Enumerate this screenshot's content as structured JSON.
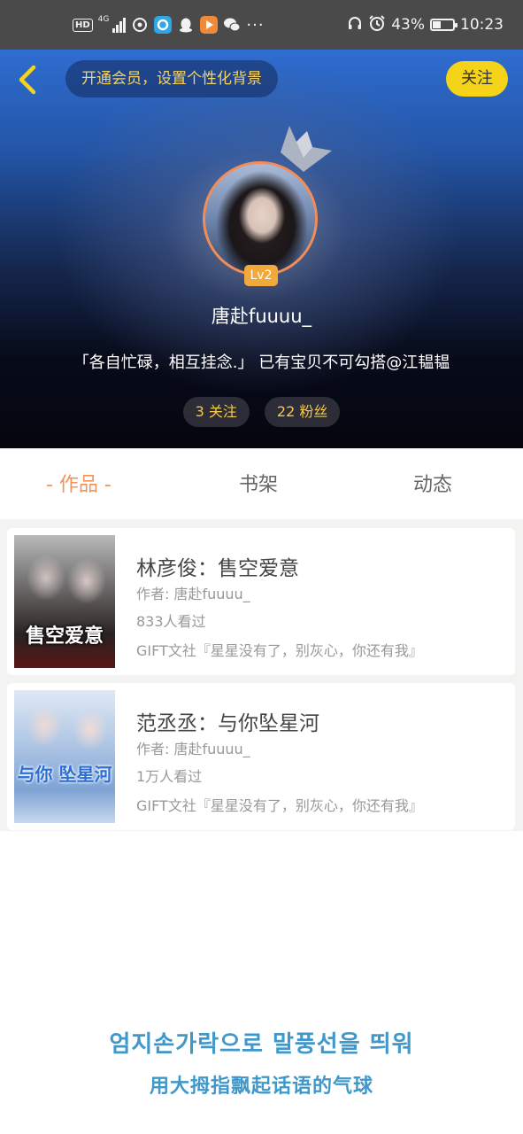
{
  "status_bar": {
    "hd": "HD",
    "network": "4G",
    "battery": "43%",
    "battery_level": 0.43,
    "time": "10:23",
    "icons": [
      "hd-icon",
      "signal-icon",
      "sync-icon",
      "browser-app-icon",
      "qq-icon",
      "video-app-icon",
      "wechat-icon",
      "more-dots-icon",
      "headphones-icon",
      "alarm-icon",
      "battery-icon"
    ]
  },
  "header": {
    "vip_banner": "开通会员，设置个性化背景",
    "follow_label": "关注",
    "level": "Lv2",
    "username": "唐赴fuuuu_",
    "bio": "「各自忙碌，相互挂念.」 已有宝贝不可勾搭@江韫韫",
    "stats": {
      "following": "3 关注",
      "fans": "22 粉丝"
    },
    "colors": {
      "accent_yellow": "#f5d319",
      "avatar_ring": "#f28c58",
      "level_badge": "#f2a93b"
    }
  },
  "tabs": {
    "works": "- 作品 -",
    "bookshelf": "书架",
    "moments": "动态",
    "active_color": "#f0935c"
  },
  "works": [
    {
      "title": "林彦俊：售空爱意",
      "author": "作者: 唐赴fuuuu_",
      "views": "833人看过",
      "desc": "GIFT文社『星星没有了，别灰心，你还有我』",
      "cover_text": "售空爱意"
    },
    {
      "title": "范丞丞：与你坠星河",
      "author": "作者: 唐赴fuuuu_",
      "views": "1万人看过",
      "desc": "GIFT文社『星星没有了，别灰心，你还有我』",
      "cover_text": "与你 坠星河"
    }
  ],
  "caption": {
    "ko": "엄지손가락으로 말풍선을 띄워",
    "zh": "用大拇指飘起话语的气球",
    "color": "#3f98c9"
  }
}
